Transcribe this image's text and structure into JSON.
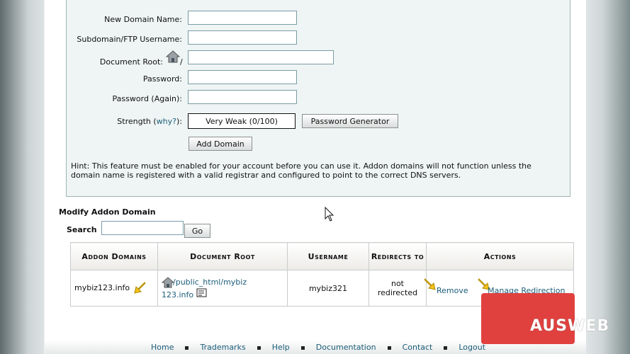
{
  "form": {
    "new_domain_label": "New Domain Name:",
    "subdomain_label": "Subdomain/FTP Username:",
    "docroot_label": "Document Root:",
    "docroot_prefix": "/",
    "password_label": "Password:",
    "password_again_label": "Password (Again):",
    "strength_label": "Strength (",
    "strength_why": "why?",
    "strength_close": "):",
    "strength_value": "Very Weak (0/100)",
    "generator_button": "Password Generator",
    "add_button": "Add Domain",
    "hint": "Hint: This feature must be enabled for your account before you can use it. Addon domains will not function unless the domain name is registered with a valid registrar and configured to point to the correct DNS servers."
  },
  "modify": {
    "title": "Modify Addon Domain",
    "search_label": "Search",
    "search_value": "",
    "go_button": "Go"
  },
  "table": {
    "headers": [
      "Addon Domains",
      "Document Root",
      "Username",
      "Redirects to",
      "Actions"
    ],
    "rows": [
      {
        "domain": "mybiz123.info",
        "docroot_line1": "/public_html/mybiz",
        "docroot_line2": "123.info",
        "username": "mybiz321",
        "redirect_line1": "not",
        "redirect_line2": "redirected",
        "remove": "Remove",
        "manage": "Manage Redirection"
      }
    ]
  },
  "footer": {
    "links": [
      "Home",
      "Trademarks",
      "Help",
      "Documentation",
      "Contact",
      "Logout"
    ]
  },
  "brand": {
    "logo_text": "AUSWEB",
    "logo_color": "#e0413f"
  }
}
